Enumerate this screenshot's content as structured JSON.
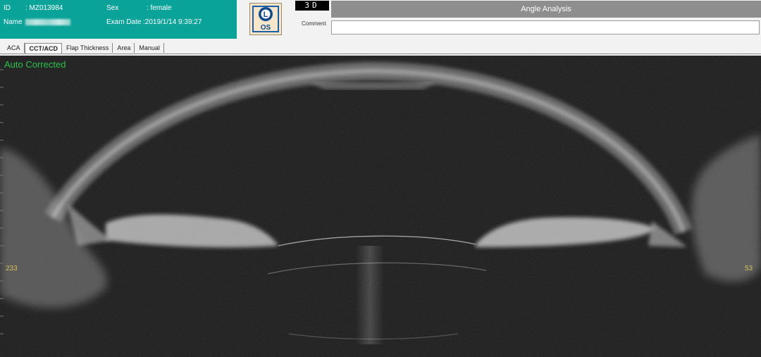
{
  "patient": {
    "id_label": "ID",
    "id_value": ": MZ013984",
    "name_label": "Name",
    "name_value": ":",
    "sex_label": "Sex",
    "sex_value": ": female",
    "exam_date_label": "Exam Date",
    "exam_date_value": ":2019/1/14 9:39:27"
  },
  "eye": {
    "letter": "L",
    "side": "OS",
    "icon": "eye-laterality-icon"
  },
  "mode": "3D",
  "title": "Angle Analysis",
  "comment": {
    "label": "Comment",
    "value": ""
  },
  "tabs": [
    {
      "label": "ACA",
      "active": false
    },
    {
      "label": "CCT/ACD",
      "active": true
    },
    {
      "label": "Flap Thickness",
      "active": false
    },
    {
      "label": "Area",
      "active": false
    },
    {
      "label": "Manual",
      "active": false
    }
  ],
  "image": {
    "status_text": "Auto Corrected",
    "left_value": "233",
    "right_value": "53",
    "colors": {
      "status": "#26c44a",
      "side_values": "#d6bf57",
      "header": "#0aa39a"
    }
  }
}
